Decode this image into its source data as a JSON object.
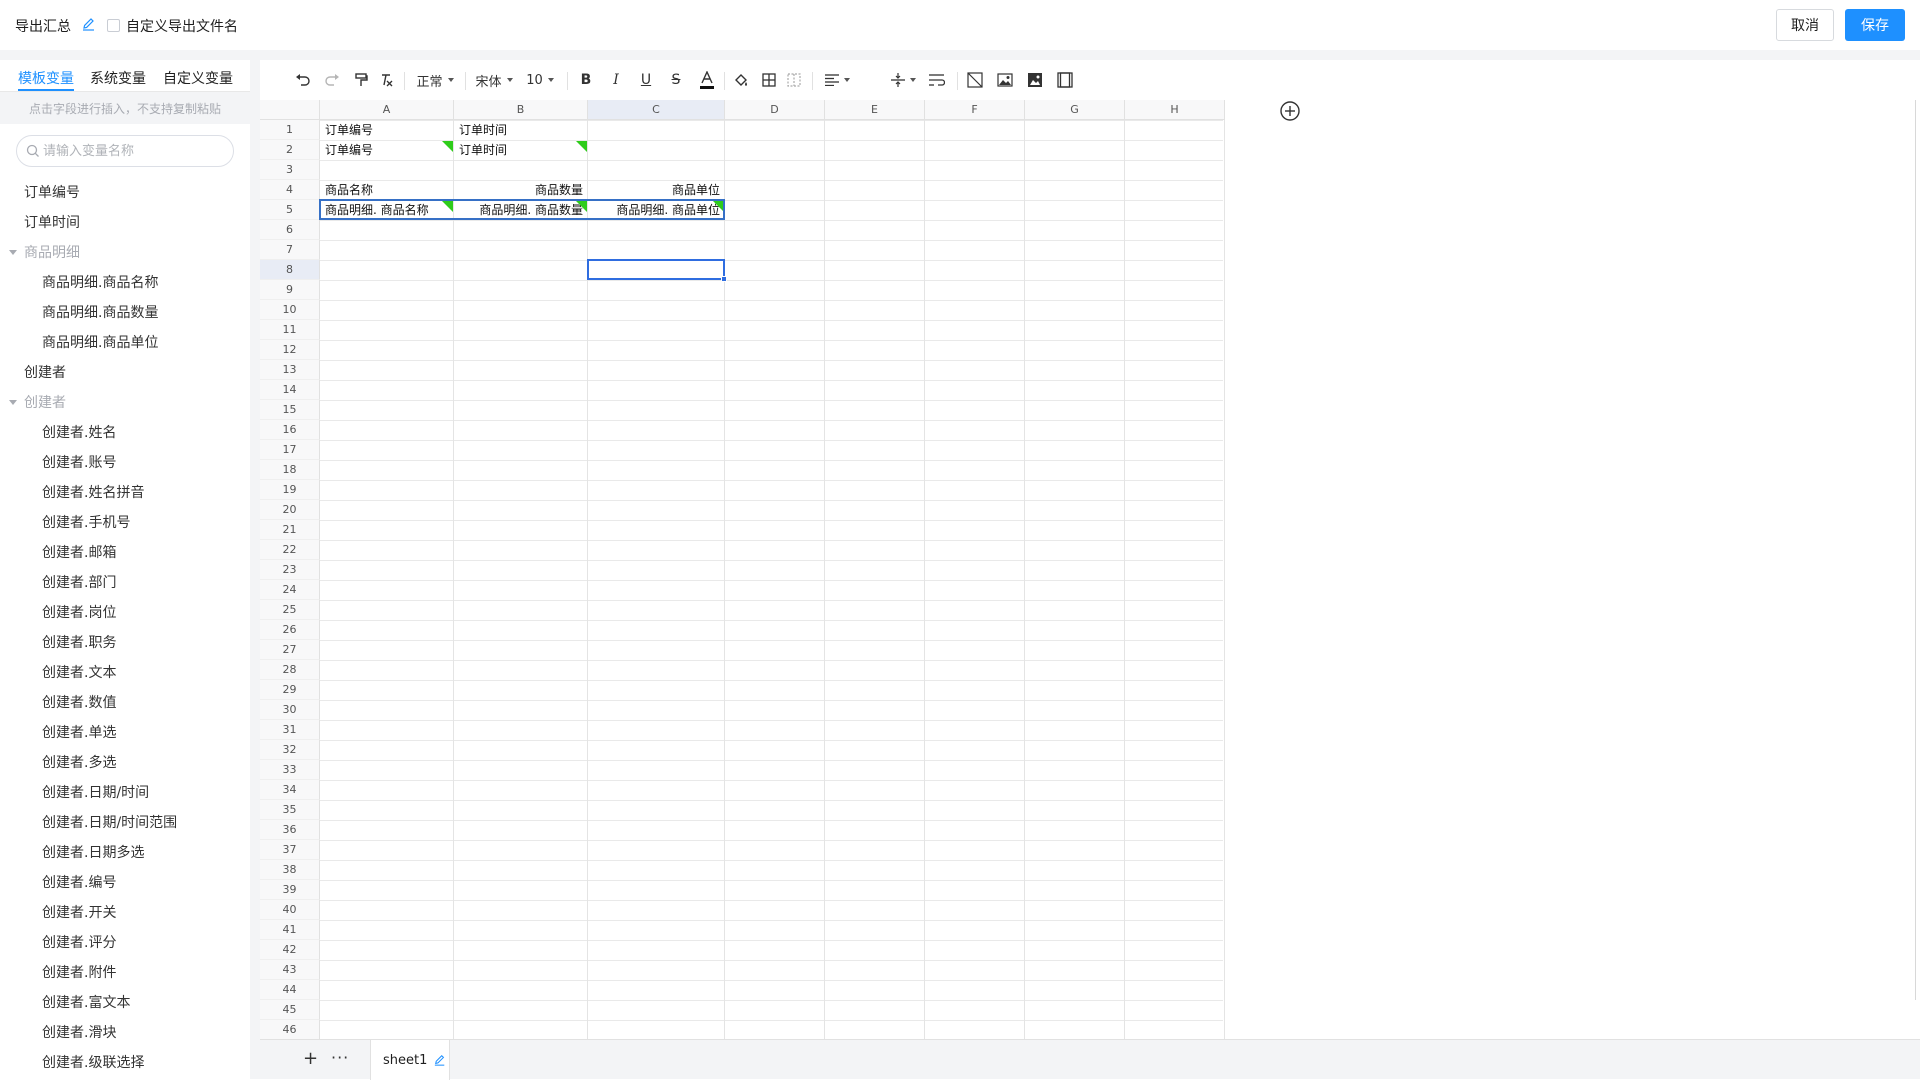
{
  "header": {
    "title": "导出汇总",
    "custom_filename_label": "自定义导出文件名",
    "cancel_label": "取消",
    "save_label": "保存"
  },
  "sidebar": {
    "tabs": [
      {
        "label": "模板变量",
        "active": true
      },
      {
        "label": "系统变量",
        "active": false
      },
      {
        "label": "自定义变量",
        "active": false
      }
    ],
    "hint": "点击字段进行插入，不支持复制粘贴",
    "search_placeholder": "请输入变量名称",
    "items": [
      {
        "label": "订单编号",
        "level": 0
      },
      {
        "label": "订单时间",
        "level": 0
      },
      {
        "label": "商品明细",
        "level": "group"
      },
      {
        "label": "商品明细.商品名称",
        "level": 1
      },
      {
        "label": "商品明细.商品数量",
        "level": 1
      },
      {
        "label": "商品明细.商品单位",
        "level": 1
      },
      {
        "label": "创建者",
        "level": 0
      },
      {
        "label": "创建者",
        "level": "group"
      },
      {
        "label": "创建者.姓名",
        "level": 1
      },
      {
        "label": "创建者.账号",
        "level": 1
      },
      {
        "label": "创建者.姓名拼音",
        "level": 1
      },
      {
        "label": "创建者.手机号",
        "level": 1
      },
      {
        "label": "创建者.邮箱",
        "level": 1
      },
      {
        "label": "创建者.部门",
        "level": 1
      },
      {
        "label": "创建者.岗位",
        "level": 1
      },
      {
        "label": "创建者.职务",
        "level": 1
      },
      {
        "label": "创建者.文本",
        "level": 1
      },
      {
        "label": "创建者.数值",
        "level": 1
      },
      {
        "label": "创建者.单选",
        "level": 1
      },
      {
        "label": "创建者.多选",
        "level": 1
      },
      {
        "label": "创建者.日期/时间",
        "level": 1
      },
      {
        "label": "创建者.日期/时间范围",
        "level": 1
      },
      {
        "label": "创建者.日期多选",
        "level": 1
      },
      {
        "label": "创建者.编号",
        "level": 1
      },
      {
        "label": "创建者.开关",
        "level": 1
      },
      {
        "label": "创建者.评分",
        "level": 1
      },
      {
        "label": "创建者.附件",
        "level": 1
      },
      {
        "label": "创建者.富文本",
        "level": 1
      },
      {
        "label": "创建者.滑块",
        "level": 1
      },
      {
        "label": "创建者.级联选择",
        "level": 1
      }
    ]
  },
  "toolbar": {
    "style_select": "正常",
    "font_select": "宋体",
    "size_select": "10"
  },
  "sheet": {
    "columns": [
      "A",
      "B",
      "C",
      "D",
      "E",
      "F",
      "G",
      "H"
    ],
    "row_count": 46,
    "active_cell": "C8",
    "cells": [
      {
        "ref": "A1",
        "text": "订单编号"
      },
      {
        "ref": "B1",
        "text": "订单时间"
      },
      {
        "ref": "A2",
        "text": "订单编号"
      },
      {
        "ref": "B2",
        "text": "订单时间"
      },
      {
        "ref": "A4",
        "text": "商品名称"
      },
      {
        "ref": "B4",
        "text": "商品数量"
      },
      {
        "ref": "C4",
        "text": "商品单位"
      },
      {
        "ref": "A5",
        "text": "商品明细. 商品名称"
      },
      {
        "ref": "B5",
        "text": "商品明细. 商品数量"
      },
      {
        "ref": "C5",
        "text": "商品明细. 商品单位"
      }
    ]
  },
  "sheetbar": {
    "tab_label": "sheet1"
  },
  "colors": {
    "accent": "#1e90ff",
    "variable_marker": "#2ecc1a",
    "selection": "#2f6de0"
  }
}
